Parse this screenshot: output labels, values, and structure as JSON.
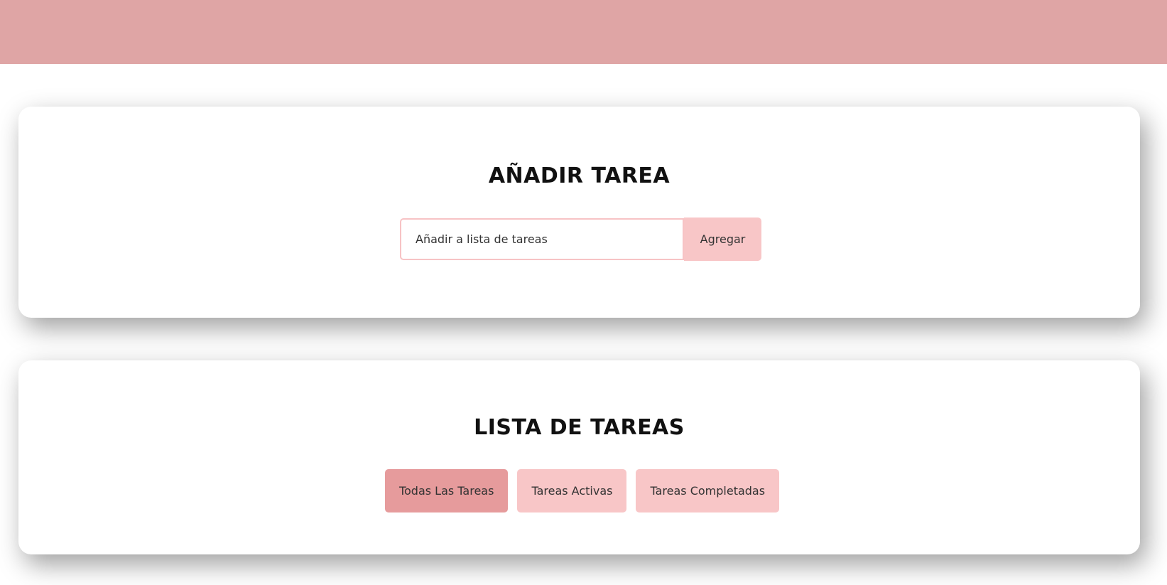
{
  "header": {
    "color": "#dfa5a5"
  },
  "add_section": {
    "title": "AÑADIR TAREA",
    "input_placeholder": "Añadir a lista de tareas",
    "input_value": "",
    "button_label": "Agregar"
  },
  "list_section": {
    "title": "LISTA DE TAREAS",
    "filters": [
      {
        "label": "Todas Las Tareas",
        "active": true
      },
      {
        "label": "Tareas Activas",
        "active": false
      },
      {
        "label": "Tareas Completadas",
        "active": false
      }
    ]
  },
  "colors": {
    "accent": "#f8c6c7",
    "accent_active": "#e69b9c",
    "header": "#dfa5a5"
  }
}
